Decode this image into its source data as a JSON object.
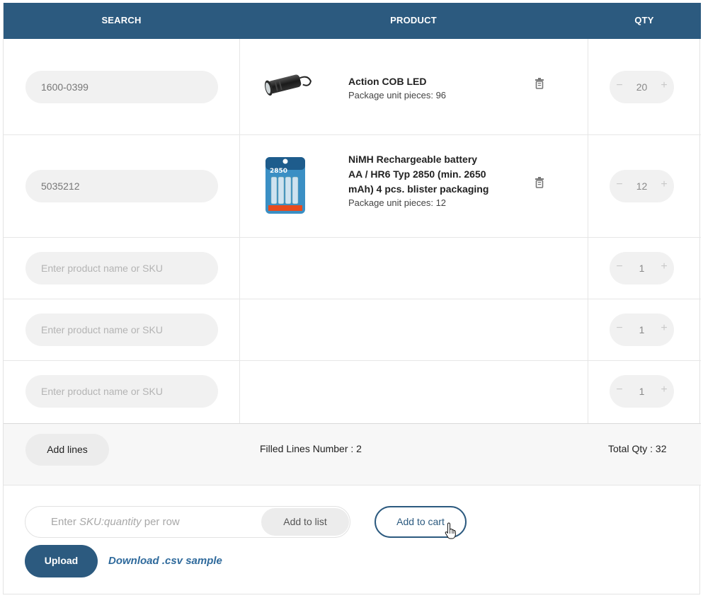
{
  "header": {
    "search_col": "SEARCH",
    "product_col": "PRODUCT",
    "qty_col": "QTY"
  },
  "rows": [
    {
      "search_value": "1600-0399",
      "product": {
        "name": "Action COB LED",
        "unit": "Package unit pieces: 96",
        "image": "flashlight-image"
      },
      "qty": "20"
    },
    {
      "search_value": "5035212",
      "product": {
        "name": "NiMH Rechargeable battery AA / HR6 Typ 2850 (min. 2650 mAh) 4 pcs. blister packaging",
        "unit": "Package unit pieces: 12",
        "image": "battery-pack-image"
      },
      "qty": "12"
    },
    {
      "search_placeholder": "Enter product name or SKU",
      "qty": "1"
    },
    {
      "search_placeholder": "Enter product name or SKU",
      "qty": "1"
    },
    {
      "search_placeholder": "Enter product name or SKU",
      "qty": "1"
    }
  ],
  "qty_controls": {
    "minus": "−",
    "plus": "+"
  },
  "summary": {
    "add_lines_label": "Add lines",
    "filled_lines": "Filled Lines Number : 2",
    "total_qty": "Total Qty : 32"
  },
  "bulk": {
    "placeholder_prefix": "Enter ",
    "placeholder_italic": "SKU:quantity",
    "placeholder_suffix": " per row",
    "add_to_list_label": "Add to list",
    "add_to_cart_label": "Add to cart"
  },
  "upload": {
    "upload_label": "Upload",
    "download_label": "Download .csv sample"
  },
  "colors": {
    "primary": "#2c5a7f",
    "pill_bg": "#f1f1f1"
  },
  "icons": [
    "trash-icon",
    "minus-icon",
    "plus-icon",
    "pointer-cursor-icon"
  ]
}
